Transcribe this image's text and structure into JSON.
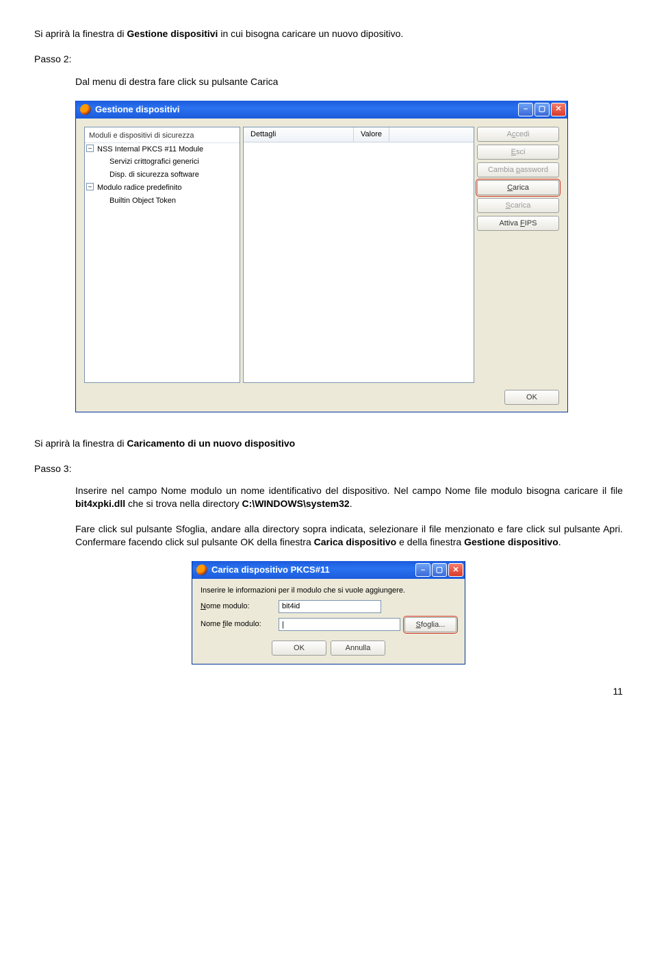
{
  "intro": {
    "prefix": "Si aprirà la finestra di ",
    "bold": "Gestione dispositivi",
    "suffix": " in cui bisogna caricare un nuovo dipositivo."
  },
  "step2": {
    "label": "Passo 2:",
    "text": "Dal menu di destra fare click su pulsante Carica"
  },
  "win1": {
    "title": "Gestione dispositivi",
    "tree_header": "Moduli e dispositivi di sicurezza",
    "items": [
      {
        "kind": "group",
        "toggle": "–",
        "label": "NSS Internal PKCS #11 Module"
      },
      {
        "kind": "child",
        "label": "Servizi crittografici generici"
      },
      {
        "kind": "child",
        "label": "Disp. di sicurezza software"
      },
      {
        "kind": "group",
        "toggle": "–",
        "label": "Modulo radice predefinito"
      },
      {
        "kind": "child",
        "label": "Builtin Object Token"
      }
    ],
    "col1": "Dettagli",
    "col2": "Valore",
    "buttons": {
      "accedi_pre": "A",
      "accedi_u": "c",
      "accedi_post": "cedi",
      "esci_u": "E",
      "esci_post": "sci",
      "cambia_pre": "Cambia ",
      "cambia_u": "p",
      "cambia_post": "assword",
      "carica_u": "C",
      "carica_post": "arica",
      "scarica_u": "S",
      "scarica_post": "carica",
      "fips_pre": "Attiva ",
      "fips_u": "F",
      "fips_post": "IPS"
    },
    "ok": "OK"
  },
  "mid1": {
    "prefix": "Si aprirà la finestra di ",
    "bold": "Caricamento di un nuovo dispositivo",
    "suffix": ""
  },
  "step3": {
    "label": "Passo 3:",
    "p1_a": "Inserire nel campo Nome modulo un nome identificativo del dispositivo. Nel campo Nome file modulo bisogna caricare il file ",
    "p1_b": "bit4xpki.dll",
    "p1_c": " che si trova nella directory ",
    "p1_d": "C:\\WINDOWS\\system32",
    "p1_e": ".",
    "p2_a": "Fare click sul pulsante Sfoglia, andare alla directory sopra indicata, selezionare il file menzionato e fare click sul pulsante Apri. Confermare facendo click sul pulsante OK della finestra ",
    "p2_b": "Carica dispositivo",
    "p2_c": " e della finestra ",
    "p2_d": "Gestione dispositivo",
    "p2_e": "."
  },
  "win2": {
    "title": "Carica dispositivo PKCS#11",
    "info": "Inserire le informazioni per il modulo che si vuole aggiungere.",
    "l1_u": "N",
    "l1_post": "ome modulo:",
    "l2_pre": "Nome ",
    "l2_u": "f",
    "l2_post": "ile modulo:",
    "v1": "bit4id",
    "v2": "|",
    "sfoglia_u": "S",
    "sfoglia_post": "foglia...",
    "ok": "OK",
    "annulla": "Annulla"
  },
  "page": "11"
}
